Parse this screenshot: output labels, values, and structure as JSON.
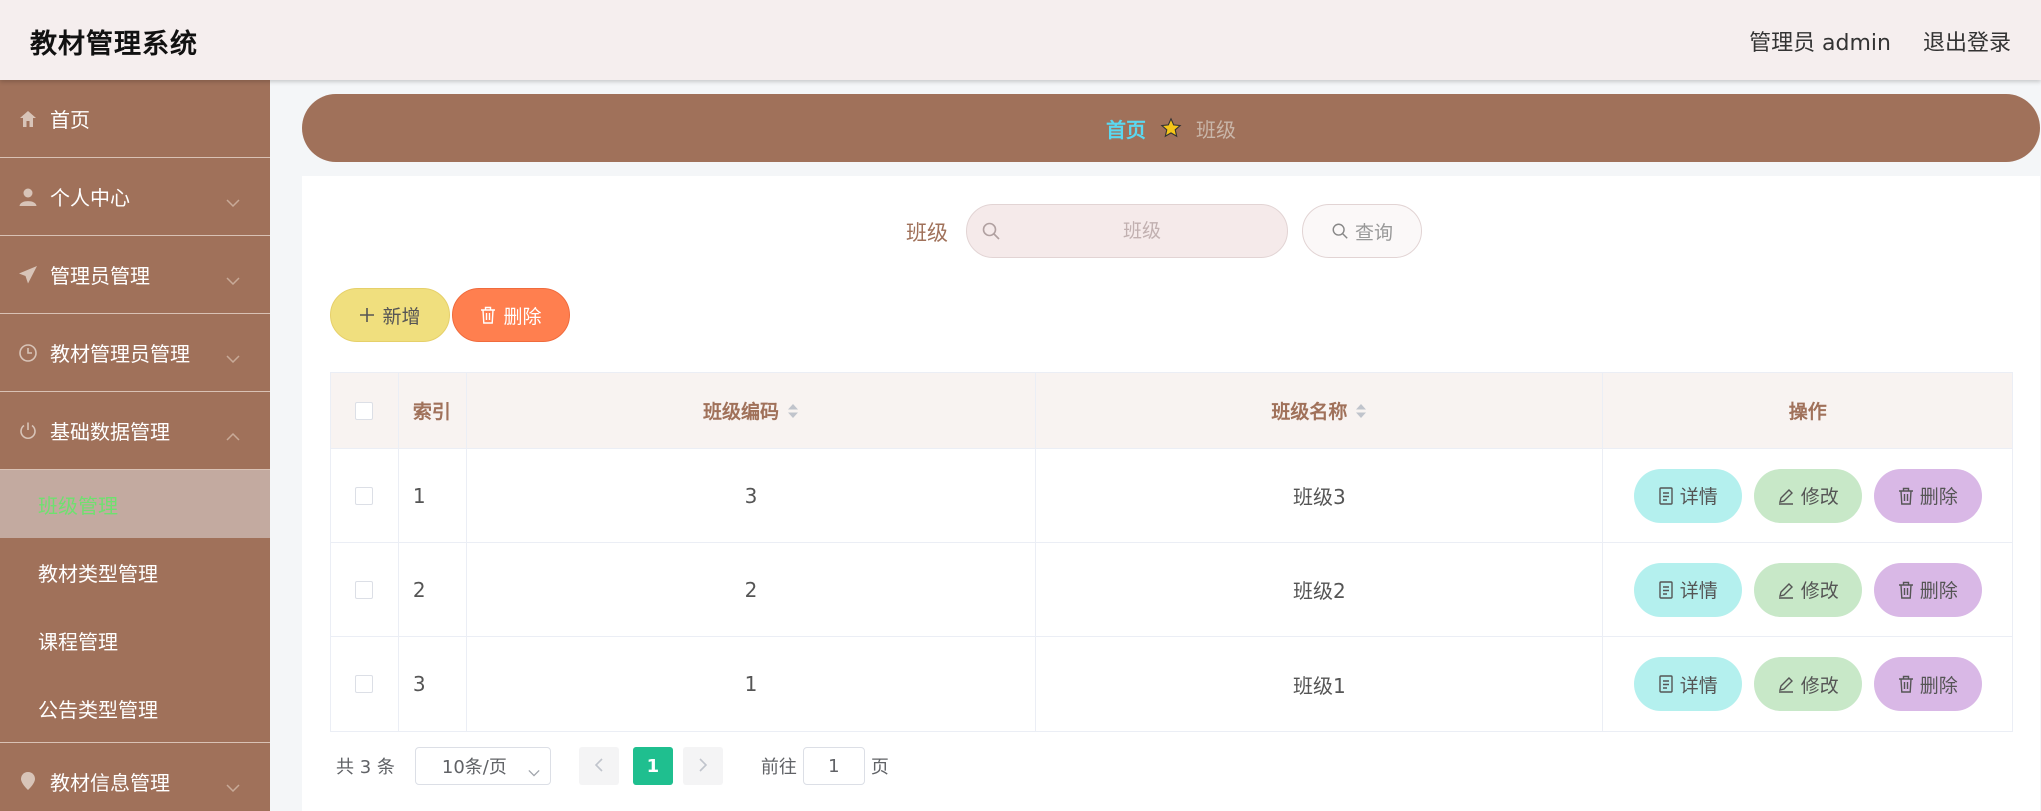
{
  "header": {
    "app_title": "教材管理系统",
    "user": "管理员 admin",
    "logout": "退出登录"
  },
  "sidebar": {
    "items": [
      {
        "label": "首页",
        "icon": "home-icon"
      },
      {
        "label": "个人中心",
        "icon": "user-icon"
      },
      {
        "label": "管理员管理",
        "icon": "send-icon"
      },
      {
        "label": "教材管理员管理",
        "icon": "clock-icon"
      },
      {
        "label": "基础数据管理",
        "icon": "power-icon"
      },
      {
        "label": "教材信息管理",
        "icon": "location-icon"
      }
    ],
    "subitems": [
      {
        "label": "班级管理",
        "active": true
      },
      {
        "label": "教材类型管理",
        "active": false
      },
      {
        "label": "课程管理",
        "active": false
      },
      {
        "label": "公告类型管理",
        "active": false
      }
    ]
  },
  "breadcrumb": {
    "home": "首页",
    "current": "班级"
  },
  "search": {
    "label": "班级",
    "placeholder": "班级",
    "query_label": "查询"
  },
  "actions": {
    "add_label": "新增",
    "delete_label": "删除"
  },
  "table": {
    "headers": {
      "index": "索引",
      "code": "班级编码",
      "name": "班级名称",
      "ops": "操作"
    },
    "rows": [
      {
        "index": "1",
        "code": "3",
        "name": "班级3"
      },
      {
        "index": "2",
        "code": "2",
        "name": "班级2"
      },
      {
        "index": "3",
        "code": "1",
        "name": "班级1"
      }
    ],
    "op_labels": {
      "detail": "详情",
      "edit": "修改",
      "remove": "删除"
    }
  },
  "pagination": {
    "total": "共 3 条",
    "page_size": "10条/页",
    "current_page": "1",
    "goto_prefix": "前往",
    "goto_value": "1",
    "goto_suffix": "页"
  },
  "colors": {
    "sidebar_bg": "#a0715a",
    "header_bg": "#f5eeee",
    "active_sub_text": "#6fe06f",
    "page_active": "#1fbf8f",
    "add_btn": "#f0df7e",
    "delete_btn": "#ff7f4f"
  }
}
